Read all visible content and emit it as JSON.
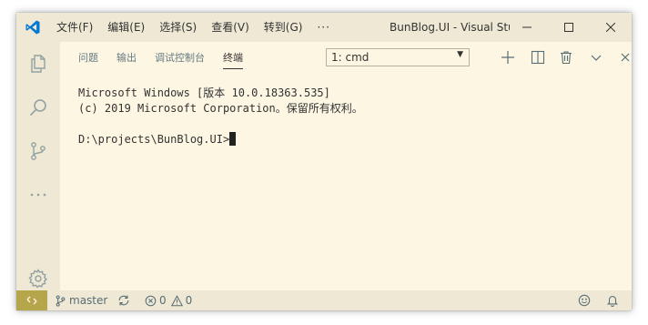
{
  "titlebar": {
    "menu": [
      "文件(F)",
      "编辑(E)",
      "选择(S)",
      "查看(V)",
      "转到(G)"
    ],
    "more": "···",
    "window_title": "BunBlog.UI - Visual Studio Code"
  },
  "panel": {
    "tabs": [
      "问题",
      "输出",
      "调试控制台",
      "终端"
    ],
    "active_tab": "终端",
    "terminal_select": "1: cmd"
  },
  "terminal": {
    "lines": [
      "Microsoft Windows [版本 10.0.18363.535]",
      "(c) 2019 Microsoft Corporation。保留所有权利。",
      "",
      "D:\\projects\\BunBlog.UI>"
    ]
  },
  "statusbar": {
    "branch": "master",
    "errors": "0",
    "warnings": "0"
  },
  "colors": {
    "background": "#fdf6e3",
    "chrome": "#eee8d5",
    "remote_indicator": "#b6a64b",
    "vscode_blue": "#0078d4"
  },
  "icons": {
    "titlebar": [
      "vscode-logo-icon",
      "minimize-icon",
      "maximize-icon",
      "close-icon"
    ],
    "activity": [
      "explorer-icon",
      "search-icon",
      "source-control-icon",
      "more-icon",
      "settings-gear-icon"
    ],
    "panel_actions": [
      "new-terminal-icon",
      "split-terminal-icon",
      "kill-terminal-icon",
      "maximize-panel-icon",
      "close-panel-icon"
    ],
    "status": [
      "remote-icon",
      "branch-icon",
      "sync-icon",
      "error-icon",
      "warning-icon",
      "feedback-smiley-icon",
      "notifications-bell-icon"
    ]
  }
}
